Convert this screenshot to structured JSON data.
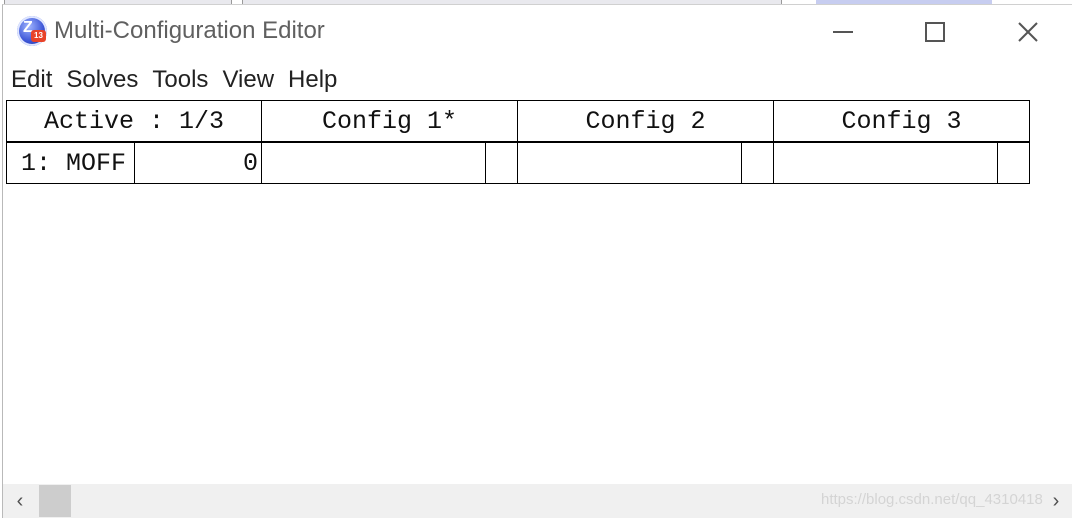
{
  "window": {
    "title": "Multi-Configuration Editor",
    "icon": "zemax-app-icon",
    "icon_badge": "13"
  },
  "menu": [
    "Edit",
    "Solves",
    "Tools",
    "View",
    "Help"
  ],
  "table": {
    "headers": [
      "Active : 1/3",
      "Config 1*",
      "Config 2",
      "Config 3"
    ],
    "rows": [
      {
        "operand": "1: MOFF",
        "param": "0",
        "config1": "",
        "config2": "",
        "config3": ""
      }
    ]
  },
  "watermark": "https://blog.csdn.net/qq_4310418",
  "colors": {
    "window_bg": "#ffffff",
    "scrollbar": "#f0f0f0",
    "thumb": "#cdcdcd",
    "title_text": "#606060"
  }
}
